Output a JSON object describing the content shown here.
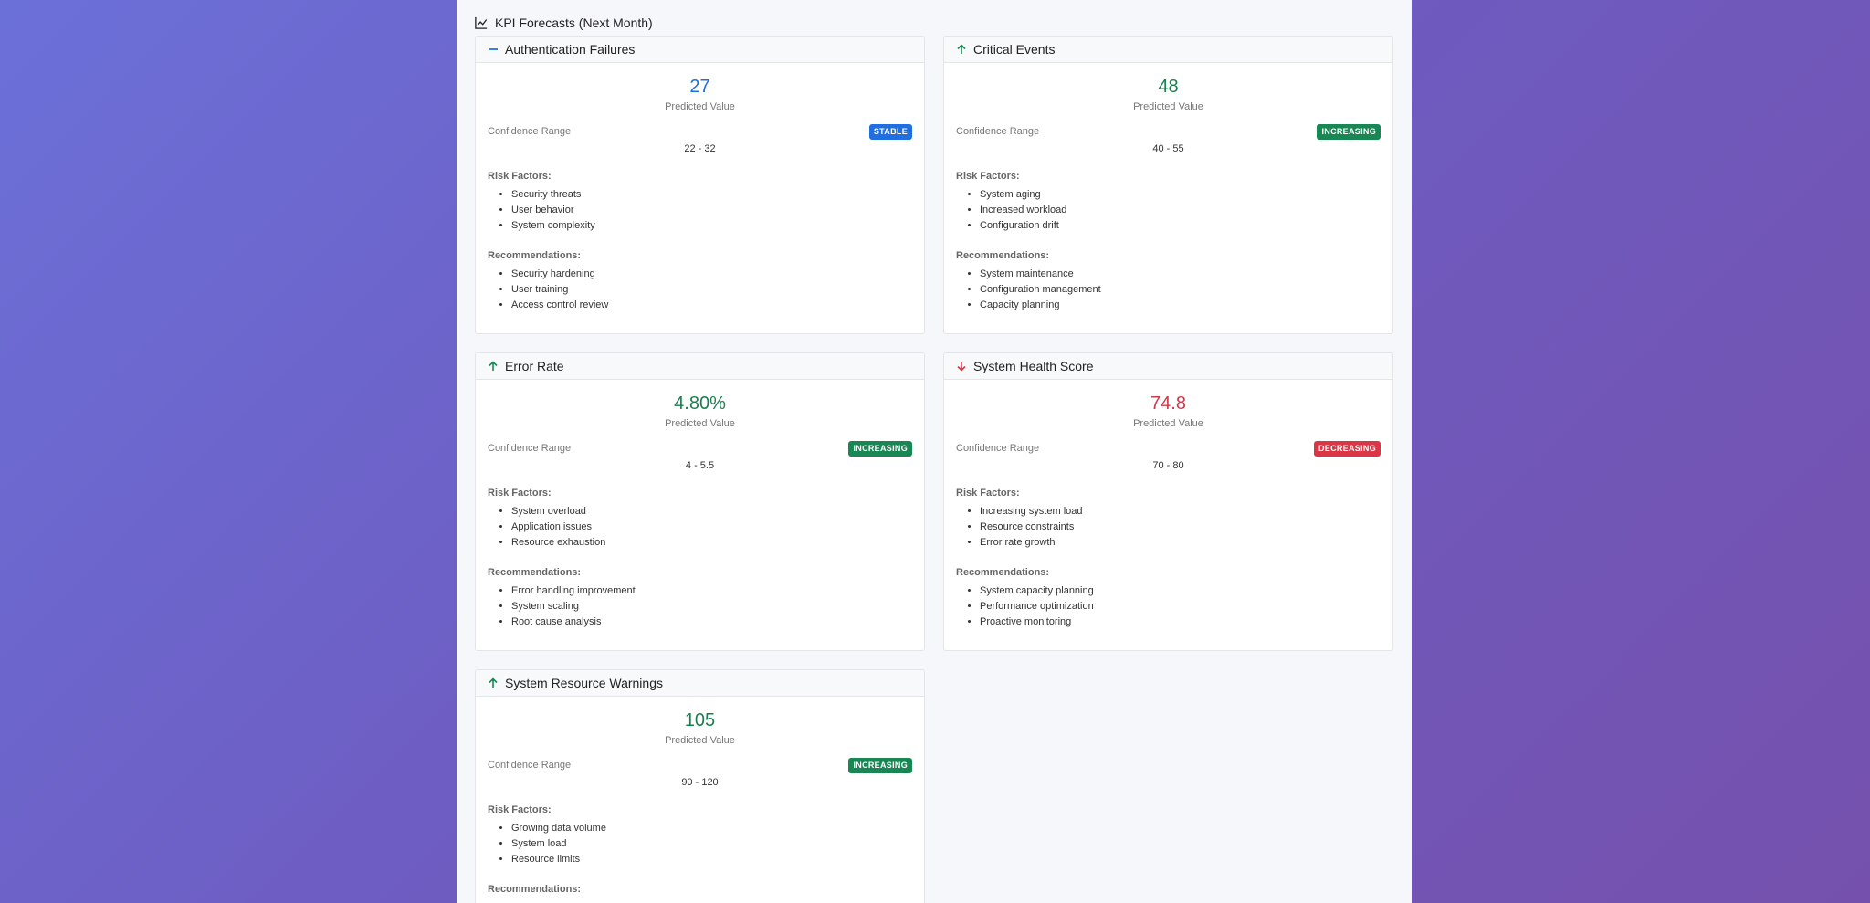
{
  "section_title": "KPI Forecasts (Next Month)",
  "colors": {
    "stable": "#1f6fe0",
    "increasing": "#198754",
    "decreasing": "#dc3545"
  },
  "labels": {
    "predicted_value": "Predicted Value",
    "confidence_range": "Confidence Range",
    "risk_factors": "Risk Factors:",
    "recommendations": "Recommendations:"
  },
  "cards": [
    {
      "title": "Authentication Failures",
      "trend_icon": "dash-icon",
      "value": "27",
      "trend": "STABLE",
      "range": "22 - 32",
      "risks": [
        "Security threats",
        "User behavior",
        "System complexity"
      ],
      "recommendations": [
        "Security hardening",
        "User training",
        "Access control review"
      ]
    },
    {
      "title": "Critical Events",
      "trend_icon": "arrow-up-icon",
      "value": "48",
      "trend": "INCREASING",
      "range": "40 - 55",
      "risks": [
        "System aging",
        "Increased workload",
        "Configuration drift"
      ],
      "recommendations": [
        "System maintenance",
        "Configuration management",
        "Capacity planning"
      ]
    },
    {
      "title": "Error Rate",
      "trend_icon": "arrow-up-icon",
      "value": "4.80%",
      "trend": "INCREASING",
      "range": "4 - 5.5",
      "risks": [
        "System overload",
        "Application issues",
        "Resource exhaustion"
      ],
      "recommendations": [
        "Error handling improvement",
        "System scaling",
        "Root cause analysis"
      ]
    },
    {
      "title": "System Health Score",
      "trend_icon": "arrow-down-icon",
      "value": "74.8",
      "trend": "DECREASING",
      "range": "70 - 80",
      "risks": [
        "Increasing system load",
        "Resource constraints",
        "Error rate growth"
      ],
      "recommendations": [
        "System capacity planning",
        "Performance optimization",
        "Proactive monitoring"
      ]
    },
    {
      "title": "System Resource Warnings",
      "trend_icon": "arrow-up-icon",
      "value": "105",
      "trend": "INCREASING",
      "range": "90 - 120",
      "risks": [
        "Growing data volume",
        "System load",
        "Resource limits"
      ],
      "recommendations": []
    }
  ]
}
